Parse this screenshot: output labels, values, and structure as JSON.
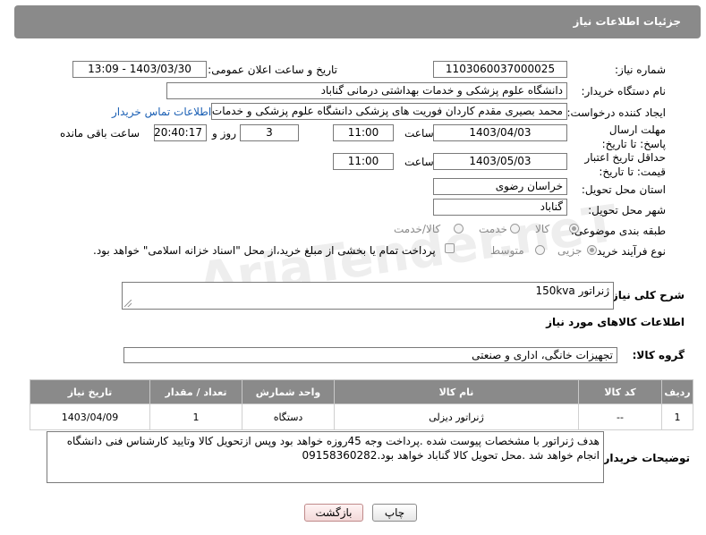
{
  "header": {
    "title": "جزئیات اطلاعات نیاز"
  },
  "fields": {
    "need_number_label": "شماره نیاز:",
    "need_number": "1103060037000025",
    "announce_label": "تاریخ و ساعت اعلان عمومی:",
    "announce_value": "1403/03/30 - 13:09",
    "buyer_org_label": "نام دستگاه خریدار:",
    "buyer_org": "دانشگاه علوم پزشکی و خدمات بهداشتی درمانی گناباد",
    "creator_label": "ایجاد کننده درخواست:",
    "creator": "محمد بصیری مقدم کاردان فوریت های پزشکی دانشگاه علوم پزشکی و خدمات",
    "contact_link": "اطلاعات تماس خریدار",
    "reply_deadline_label": "مهلت ارسال پاسخ: تا تاریخ:",
    "reply_date": "1403/04/03",
    "time_label": "ساعت",
    "reply_time": "11:00",
    "days_value": "3",
    "days_label": "روز و",
    "remaining_time": "20:40:17",
    "remaining_label": "ساعت باقی مانده",
    "validity_label": "حداقل تاریخ اعتبار قیمت: تا تاریخ:",
    "validity_date": "1403/05/03",
    "validity_time": "11:00",
    "province_label": "استان محل تحویل:",
    "province": "خراسان رضوی",
    "city_label": "شهر محل تحویل:",
    "city": "گناباد",
    "category_label": "طبقه بندی موضوعی:",
    "category_options": [
      "کالا",
      "خدمت",
      "کالا/خدمت"
    ],
    "process_label": "نوع فرآیند خرید :",
    "process_options": [
      "جزیی",
      "متوسط"
    ],
    "payment_note": "پرداخت تمام یا بخشی از مبلغ خرید،از محل \"اسناد خزانه اسلامی\" خواهد بود."
  },
  "description": {
    "label": "شرح کلی نیاز:",
    "value": "ژنراتور 150kva"
  },
  "goods_section": {
    "title": "اطلاعات کالاهای مورد نیاز",
    "group_label": "گروه کالا:",
    "group_value": "تجهیزات خانگی، اداری و صنعتی"
  },
  "table": {
    "headers": [
      "ردیف",
      "کد کالا",
      "نام کالا",
      "واحد شمارش",
      "تعداد / مقدار",
      "تاریخ نیاز"
    ],
    "rows": [
      [
        "1",
        "--",
        "ژنراتور دیزلی",
        "دستگاه",
        "1",
        "1403/04/09"
      ]
    ]
  },
  "buyer_notes": {
    "label": "توضیحات خریدار:",
    "value": "هدف ژنراتور با مشخصات پیوست شده .پرداخت وجه 45روزه خواهد بود وپس ازتحویل کالا وتایید کارشناس فنی دانشگاه انجام خواهد شد .محل تحویل کالا گناباد خواهد بود.09158360282"
  },
  "buttons": {
    "print": "چاپ",
    "back": "بازگشت"
  },
  "watermark": "AriaTender.neT"
}
